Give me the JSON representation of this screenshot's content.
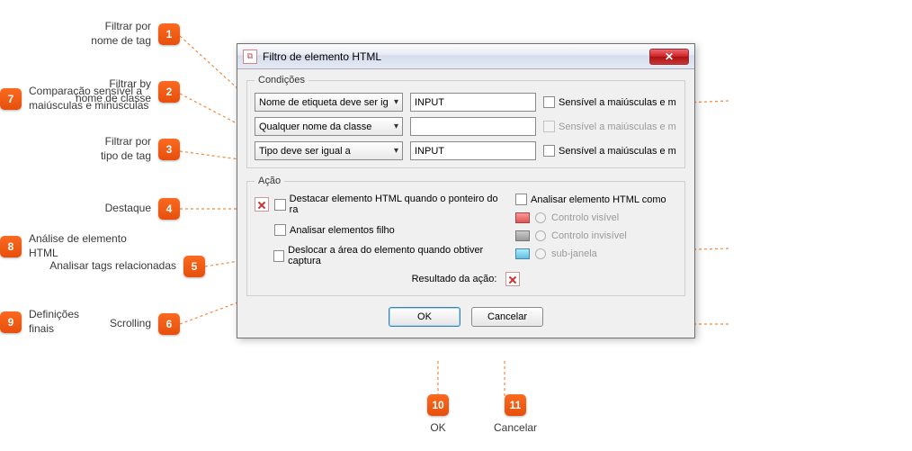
{
  "window": {
    "title": "Filtro de elemento HTML"
  },
  "fieldset": {
    "cond_legend": "Condições",
    "acao_legend": "Ação"
  },
  "cond": {
    "r1": {
      "select": "Nome de etiqueta deve ser ig",
      "value": "INPUT",
      "case": "Sensível a maiúsculas e m"
    },
    "r2": {
      "select": "Qualquer nome da classe",
      "value": "",
      "case": "Sensível a maiúsculas e m"
    },
    "r3": {
      "select": "Tipo deve ser igual a",
      "value": "INPUT",
      "case": "Sensível a maiúsculas e m"
    }
  },
  "acao": {
    "highlight": "Destacar elemento HTML quando o ponteiro do ra",
    "children": "Analisar elementos filho",
    "scroll": "Deslocar a área do elemento quando obtiver captura",
    "analyze": "Analisar elemento HTML como",
    "opt_visible": "Controlo visível",
    "opt_invisible": "Controlo invisível",
    "opt_subwin": "sub-janela",
    "result_label": "Resultado da ação:"
  },
  "buttons": {
    "ok": "OK",
    "cancel": "Cancelar"
  },
  "anno": {
    "1": "Filtrar por\nnome de tag",
    "2": "Filtrar by\nnome de classe",
    "3": "Filtrar por\ntipo de tag",
    "4": "Destaque",
    "5": "Analisar tags relacionadas",
    "6": "Scrolling",
    "7": "Comparação sensível a\nmaiúsculas e minúsculas",
    "8": "Análise de elemento\nHTML",
    "9": "Definições\nfinais",
    "10": "OK",
    "11": "Cancelar"
  }
}
